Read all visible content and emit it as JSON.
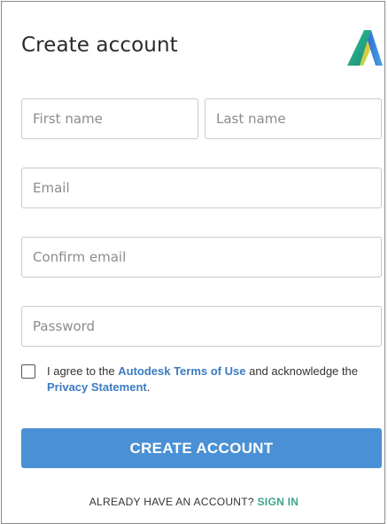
{
  "header": {
    "title": "Create account",
    "logo_icon": "autodesk-logo-icon"
  },
  "form": {
    "first_name": {
      "placeholder": "First name",
      "value": ""
    },
    "last_name": {
      "placeholder": "Last name",
      "value": ""
    },
    "email": {
      "placeholder": "Email",
      "value": ""
    },
    "confirm_email": {
      "placeholder": "Confirm email",
      "value": ""
    },
    "password": {
      "placeholder": "Password",
      "value": ""
    }
  },
  "agreement": {
    "checked": false,
    "text_1": "I agree to the ",
    "terms_link": "Autodesk Terms of Use",
    "text_2": " and acknowledge the ",
    "privacy_link": "Privacy Statement",
    "text_3": "."
  },
  "actions": {
    "create_label": "CREATE ACCOUNT"
  },
  "footer": {
    "prompt": "ALREADY HAVE AN ACCOUNT? ",
    "signin_link": "SIGN IN"
  },
  "colors": {
    "primary_button": "#4a90d4",
    "link_blue": "#3b7bc1",
    "link_green": "#3aa38e"
  }
}
